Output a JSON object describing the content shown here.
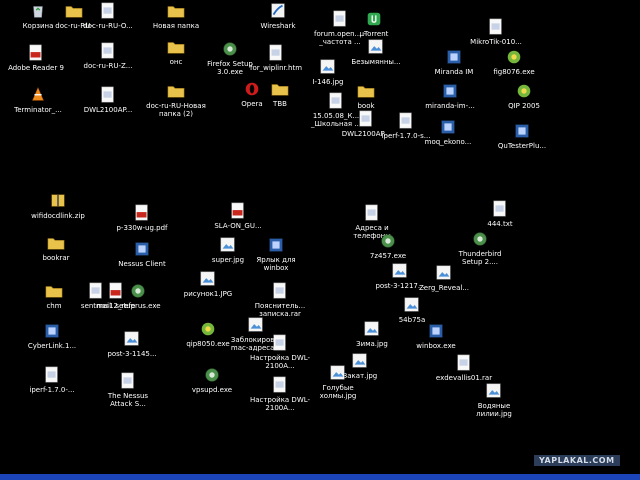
{
  "desktop": {
    "icons": [
      {
        "label": "Корзина",
        "type": "recycle"
      },
      {
        "label": "doc-ru-RU-",
        "type": "folder"
      },
      {
        "label": "doc-ru-RU-O...",
        "type": "doc"
      },
      {
        "label": "Новая папка",
        "type": "folder"
      },
      {
        "label": "Wireshark",
        "type": "wireshark"
      },
      {
        "label": "forum.open... - _частота ...",
        "type": "doc"
      },
      {
        "label": "µTorrent",
        "type": "utorrent"
      },
      {
        "label": "MikroTik-010...",
        "type": "doc"
      },
      {
        "label": "Adobe Reader 9",
        "type": "pdf"
      },
      {
        "label": "doc-ru-RU-Z...",
        "type": "doc"
      },
      {
        "label": "онс",
        "type": "folder"
      },
      {
        "label": "Firefox Setup 3.0.exe",
        "type": "setup"
      },
      {
        "label": "for_wiplinr.htm",
        "type": "doc"
      },
      {
        "label": "Безымянны...",
        "type": "image"
      },
      {
        "label": "Miranda IM",
        "type": "app"
      },
      {
        "label": "fig8076.exe",
        "type": "qip"
      },
      {
        "label": "Terminator_...",
        "type": "vlc"
      },
      {
        "label": "DWL2100AP...",
        "type": "doc"
      },
      {
        "label": "doc-ru-RU-Новая папка (2)",
        "type": "folder"
      },
      {
        "label": "Opera",
        "type": "opera"
      },
      {
        "label": "TBB",
        "type": "folder"
      },
      {
        "label": "I-146.jpg",
        "type": "image"
      },
      {
        "label": "book",
        "type": "folder"
      },
      {
        "label": "miranda-im-...",
        "type": "app"
      },
      {
        "label": "QIP 2005",
        "type": "qip"
      },
      {
        "label": "15.05.08_К... _Школьная ...",
        "type": "doc"
      },
      {
        "label": "DWL2100AP...",
        "type": "doc"
      },
      {
        "label": "iperf-1.7.0-s...",
        "type": "doc"
      },
      {
        "label": "moq_ekono...",
        "type": "app"
      },
      {
        "label": "QuTesterPlu...",
        "type": "app"
      },
      {
        "label": "wifidocdlink.zip",
        "type": "zip"
      },
      {
        "label": "p-330w-ug.pdf",
        "type": "pdf"
      },
      {
        "label": "SLA-ON_GU...",
        "type": "pdf"
      },
      {
        "label": "Адреса и телефоны",
        "type": "doc"
      },
      {
        "label": "444.txt",
        "type": "doc"
      },
      {
        "label": "bookrar",
        "type": "folder"
      },
      {
        "label": "Nessus Client",
        "type": "app"
      },
      {
        "label": "super.jpg",
        "type": "image"
      },
      {
        "label": "Ярлык для winbox",
        "type": "app"
      },
      {
        "label": "7z457.exe",
        "type": "setup"
      },
      {
        "label": "Thunderbird Setup 2....",
        "type": "setup"
      },
      {
        "label": "chm",
        "type": "folder"
      },
      {
        "label": "sentmail",
        "type": "doc"
      },
      {
        "label": "nas12_refe",
        "type": "pdf"
      },
      {
        "label": "setuprus.exe",
        "type": "setup"
      },
      {
        "label": "рисунок1.JPG",
        "type": "image"
      },
      {
        "label": "Пояснитель... записка.rar",
        "type": "doc"
      },
      {
        "label": "post-3-1217...",
        "type": "image"
      },
      {
        "label": "Zerg_Reveal...",
        "type": "image"
      },
      {
        "label": "CyberLink.1...",
        "type": "app"
      },
      {
        "label": "qip8050.exe",
        "type": "qip"
      },
      {
        "label": "Заблокиров... mac-адреса...",
        "type": "image"
      },
      {
        "label": "54b75a",
        "type": "image"
      },
      {
        "label": "post-3-1145...",
        "type": "image"
      },
      {
        "label": "Настройка DWL-2100A...",
        "type": "doc"
      },
      {
        "label": "Зима.jpg",
        "type": "image"
      },
      {
        "label": "winbox.exe",
        "type": "app"
      },
      {
        "label": "iperf-1.7.0-...",
        "type": "doc"
      },
      {
        "label": "The Nessus Attack S...",
        "type": "doc"
      },
      {
        "label": "vpsupd.exe",
        "type": "setup"
      },
      {
        "label": "Настройка DWL-2100A...",
        "type": "doc"
      },
      {
        "label": "Закат.jpg",
        "type": "image"
      },
      {
        "label": "exdevallis01.rar",
        "type": "doc"
      },
      {
        "label": "Голубые холмы.jpg",
        "type": "image"
      },
      {
        "label": "Водяные лилии.jpg",
        "type": "image"
      }
    ]
  },
  "watermark": {
    "text": "YAPLAKAL.COM"
  },
  "colors": {
    "desktop_bg": "#000000",
    "taskbar": "#1a44b8",
    "watermark_bg": "#2b3d59"
  }
}
